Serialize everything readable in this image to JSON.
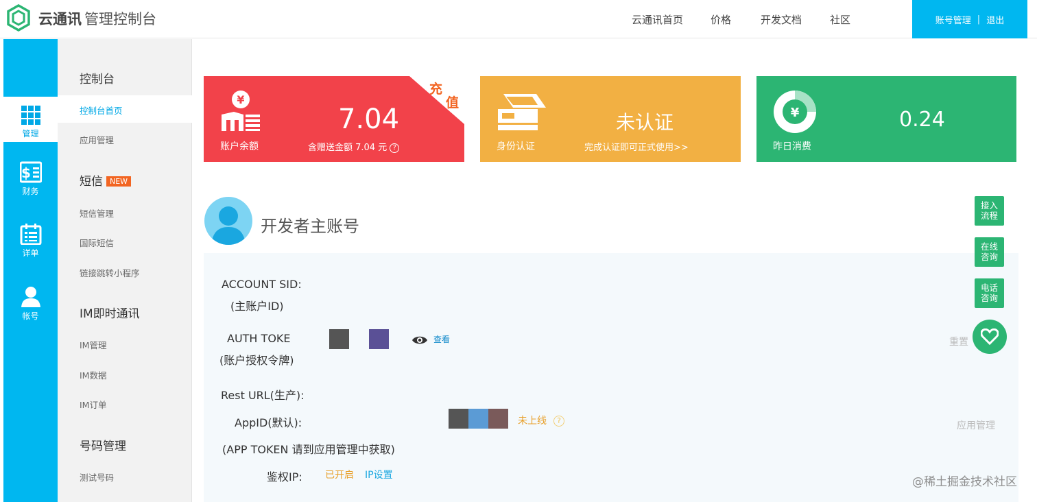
{
  "header": {
    "brand_bold": "云通讯",
    "brand_rest": "管理控制台",
    "nav": [
      "云通讯首页",
      "价格",
      "开发文档",
      "社区"
    ],
    "account": "账号管理",
    "separator": "|",
    "logout": "退出"
  },
  "rail": {
    "items": [
      {
        "label": "管理",
        "icon": "grid-icon"
      },
      {
        "label": "财务",
        "icon": "finance-icon"
      },
      {
        "label": "详单",
        "icon": "calendar-list-icon"
      },
      {
        "label": "帐号",
        "icon": "user-icon"
      }
    ]
  },
  "submenu": {
    "console": "控制台",
    "console_home": "控制台首页",
    "app_manage": "应用管理",
    "sms": "短信",
    "new_badge": "NEW",
    "sms_manage": "短信管理",
    "intl_sms": "国际短信",
    "link_jump": "链接跳转小程序",
    "im": "IM即时通讯",
    "im_manage": "IM管理",
    "im_data": "IM数据",
    "im_order": "IM订单",
    "number_manage": "号码管理",
    "test_number": "测试号码"
  },
  "cards": {
    "balance": {
      "label": "账户余额",
      "value": "7.04",
      "sub": "含赠送金额 7.04 元",
      "help": "?",
      "corner_1": "充",
      "corner_2": "值",
      "icon": "money-stack-icon",
      "color": "#f2424a"
    },
    "identity": {
      "label": "身份认证",
      "value": "未认证",
      "sub": "完成认证即可正式使用>>",
      "icon": "id-scanner-icon",
      "color": "#f2b043"
    },
    "yesterday": {
      "label": "昨日消费",
      "value": "0.24",
      "icon": "yen-pie-icon",
      "color": "#2cb573"
    }
  },
  "developer": {
    "title": "开发者主账号",
    "account_sid": "ACCOUNT SID:",
    "account_sid_sub": "(主账户ID)",
    "auth_token": "AUTH TOKE",
    "auth_token_sub": "(账户授权令牌)",
    "view": "查看",
    "reset": "重置",
    "rest_url": "Rest URL(生产):",
    "appid": "AppID(默认):",
    "app_status": "未上线",
    "app_help": "?",
    "app_manage": "应用管理",
    "app_token_note": "(APP TOKEN 请到应用管理中获取)",
    "auth_ip": "鉴权IP:",
    "ip_enabled": "已开启",
    "ip_settings": "IP设置"
  },
  "floating": {
    "access_flow_1": "接入",
    "access_flow_2": "流程",
    "online_1": "在线",
    "online_2": "咨询",
    "phone_1": "电话",
    "phone_2": "咨询"
  },
  "watermark": "@稀土掘金技术社区",
  "colors": {
    "primary_blue": "#00b7f0",
    "red": "#f2424a",
    "orange": "#f2b043",
    "green": "#2cb573",
    "accent_orange": "#f26522"
  }
}
